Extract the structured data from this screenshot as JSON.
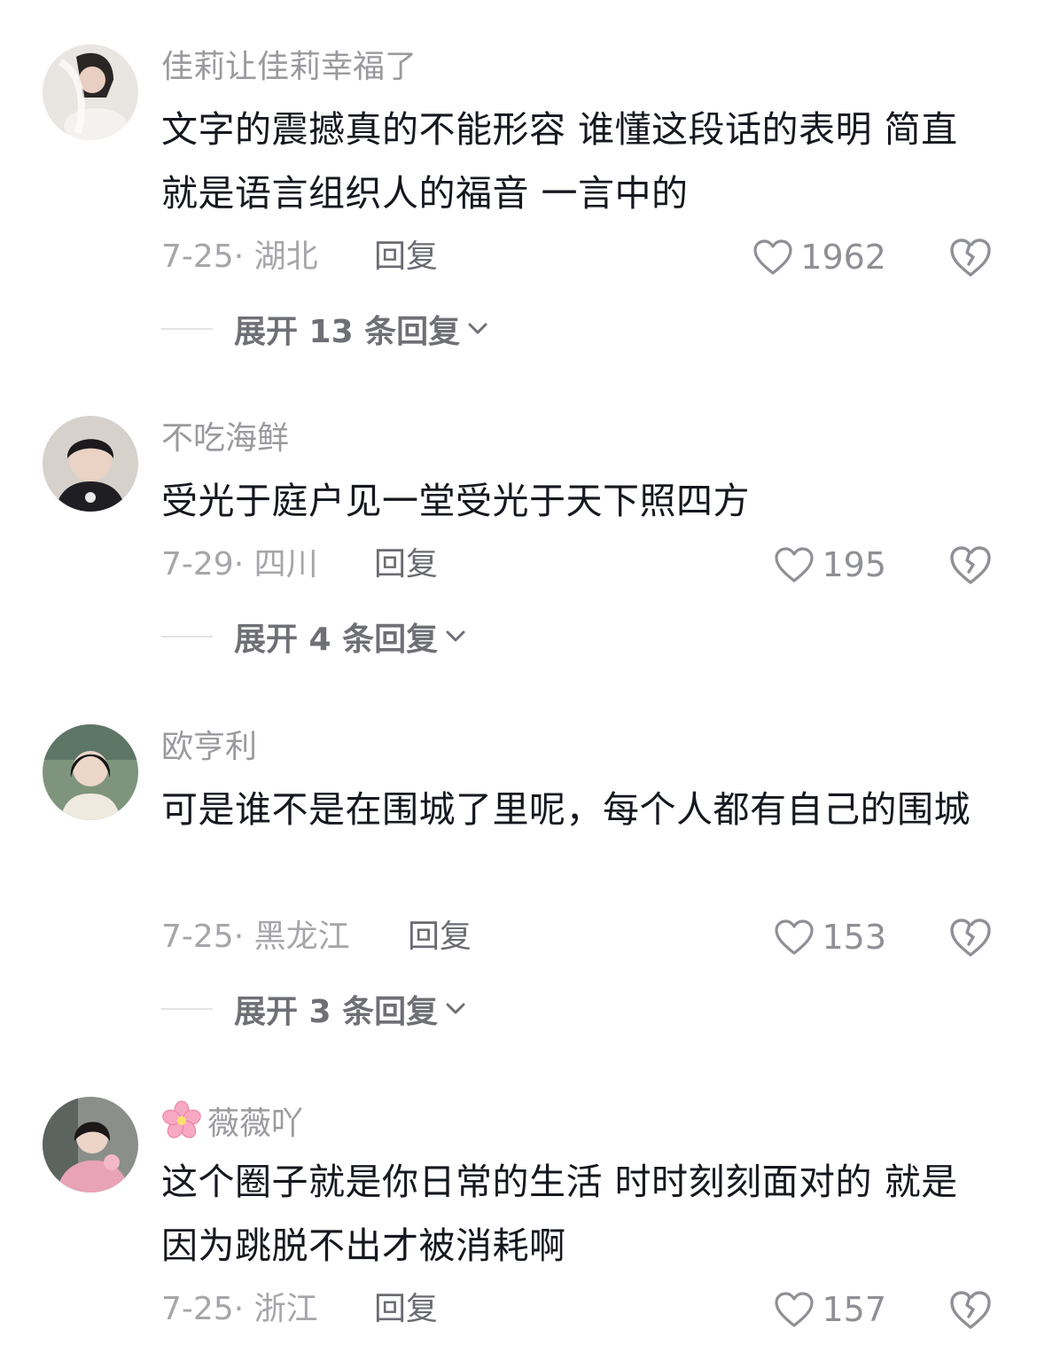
{
  "comments": [
    {
      "username": "佳莉让佳莉幸福了",
      "text": "文字的震撼真的不能形容 谁懂这段话的表明 简直就是语言组织人的福音 一言中的",
      "date_location": "7-25· 湖北",
      "reply_label": "回复",
      "likes": "1962",
      "expand_label": "展开 13 条回复"
    },
    {
      "username": "不吃海鲜",
      "text": "受光于庭户见一堂受光于天下照四方",
      "date_location": "7-29· 四川",
      "reply_label": "回复",
      "likes": "195",
      "expand_label": "展开 4 条回复"
    },
    {
      "username": "欧亨利",
      "text": "可是谁不是在围城了里呢，每个人都有自己的围城",
      "date_location": "7-25· 黑龙江",
      "reply_label": "回复",
      "likes": "153",
      "expand_label": "展开 3 条回复"
    },
    {
      "username": "薇薇吖",
      "username_emoji": "cherry-blossom-icon",
      "text": "这个圈子就是你日常的生活 时时刻刻面对的 就是因为跳脱不出才被消耗啊",
      "date_location": "7-25· 浙江",
      "reply_label": "回复",
      "likes": "157"
    }
  ],
  "colors": {
    "text_primary": "#16181f",
    "text_secondary": "#9a9a9e",
    "icon_gray": "#8f9096"
  }
}
